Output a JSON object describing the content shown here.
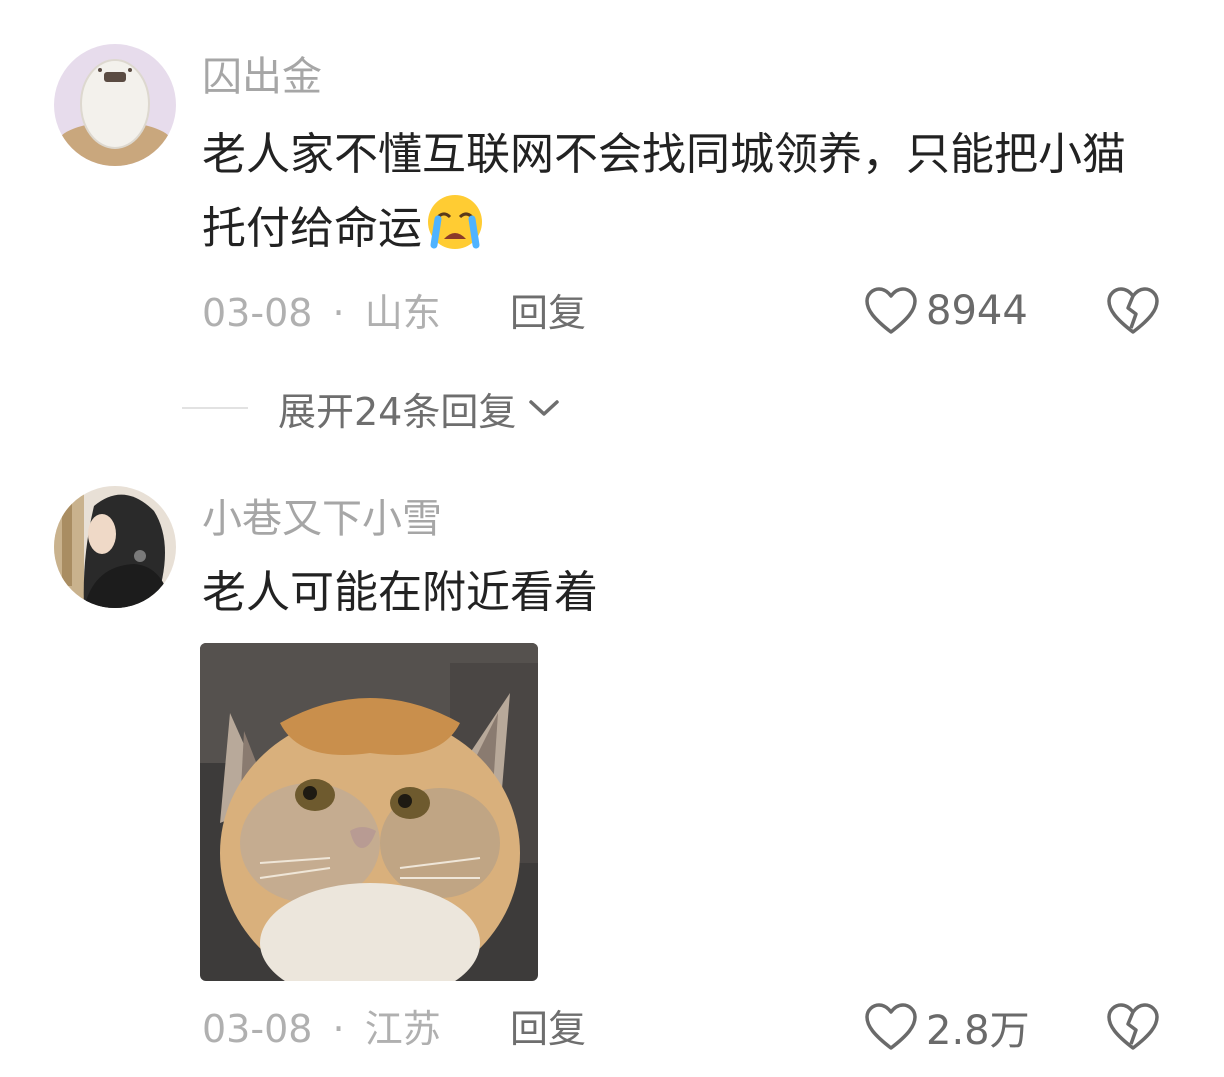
{
  "comments": [
    {
      "username": "囚出金",
      "text": "老人家不懂互联网不会找同城领养，只能把小猫托付给命运",
      "emoji": "crying-face-icon",
      "date": "03-08",
      "separator": "·",
      "location": "山东",
      "reply_label": "回复",
      "likes": "8944"
    },
    {
      "username": "小巷又下小雪",
      "text": "老人可能在附近看着",
      "date": "03-08",
      "separator": "·",
      "location": "江苏",
      "reply_label": "回复",
      "likes": "2.8万"
    }
  ],
  "expand_replies": {
    "label": "展开24条回复"
  },
  "colors": {
    "username": "#a6a6a6",
    "content": "#222222",
    "meta": "#b0b0b0",
    "action": "#6e6e6e",
    "emoji": "#ffcc33"
  }
}
